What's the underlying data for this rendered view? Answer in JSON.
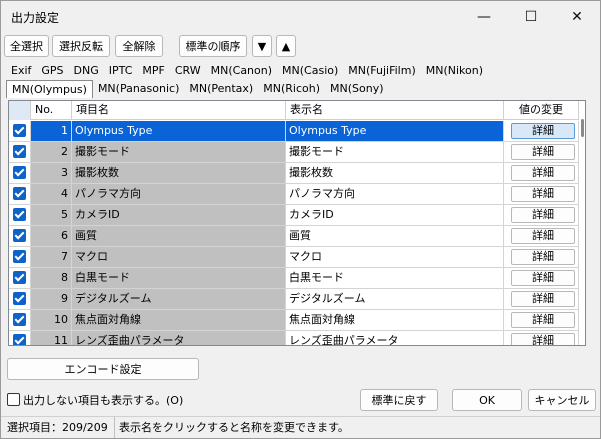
{
  "window": {
    "title": "出力設定",
    "minimize": "—",
    "maximize": "☐",
    "close": "✕"
  },
  "toolbar": {
    "select_all": "全選択",
    "invert_selection": "選択反転",
    "deselect_all": "全解除",
    "standard_order": "標準の順序",
    "move_down": "▼",
    "move_up": "▲"
  },
  "tabs_row1": [
    "Exif",
    "GPS",
    "DNG",
    "IPTC",
    "MPF",
    "CRW",
    "MN(Canon)",
    "MN(Casio)",
    "MN(FujiFilm)",
    "MN(Nikon)"
  ],
  "tabs_row2": [
    "MN(Olympus)",
    "MN(Panasonic)",
    "MN(Pentax)",
    "MN(Ricoh)",
    "MN(Sony)"
  ],
  "grid": {
    "columns": {
      "no": "No.",
      "item": "項目名",
      "display": "表示名",
      "change": "値の変更"
    },
    "rows": [
      {
        "no": "1",
        "item": "Olympus Type",
        "display": "Olympus Type",
        "button": "詳細",
        "selected": true
      },
      {
        "no": "2",
        "item": "撮影モード",
        "display": "撮影モード",
        "button": "詳細"
      },
      {
        "no": "3",
        "item": "撮影枚数",
        "display": "撮影枚数",
        "button": "詳細"
      },
      {
        "no": "4",
        "item": "パノラマ方向",
        "display": "パノラマ方向",
        "button": "詳細"
      },
      {
        "no": "5",
        "item": "カメラID",
        "display": "カメラID",
        "button": "詳細"
      },
      {
        "no": "6",
        "item": "画質",
        "display": "画質",
        "button": "詳細"
      },
      {
        "no": "7",
        "item": "マクロ",
        "display": "マクロ",
        "button": "詳細"
      },
      {
        "no": "8",
        "item": "白黒モード",
        "display": "白黒モード",
        "button": "詳細"
      },
      {
        "no": "9",
        "item": "デジタルズーム",
        "display": "デジタルズーム",
        "button": "詳細"
      },
      {
        "no": "10",
        "item": "焦点面対角線",
        "display": "焦点面対角線",
        "button": "詳細"
      },
      {
        "no": "11",
        "item": "レンズ歪曲パラメータ",
        "display": "レンズ歪曲パラメータ",
        "button": "詳細"
      }
    ]
  },
  "encode_button": "エンコード設定",
  "show_hidden_label": "出力しない項目も表示する。(O)",
  "reset_button": "標準に戻す",
  "ok_button": "OK",
  "cancel_button": "キャンセル",
  "status": {
    "selected": "選択項目：209/209",
    "hint": "表示名をクリックすると名称を変更できます。"
  },
  "colors": {
    "selection": "#0a64d8",
    "checkbox": "#0e63c9",
    "readonly_cell": "#c0c0c0"
  }
}
